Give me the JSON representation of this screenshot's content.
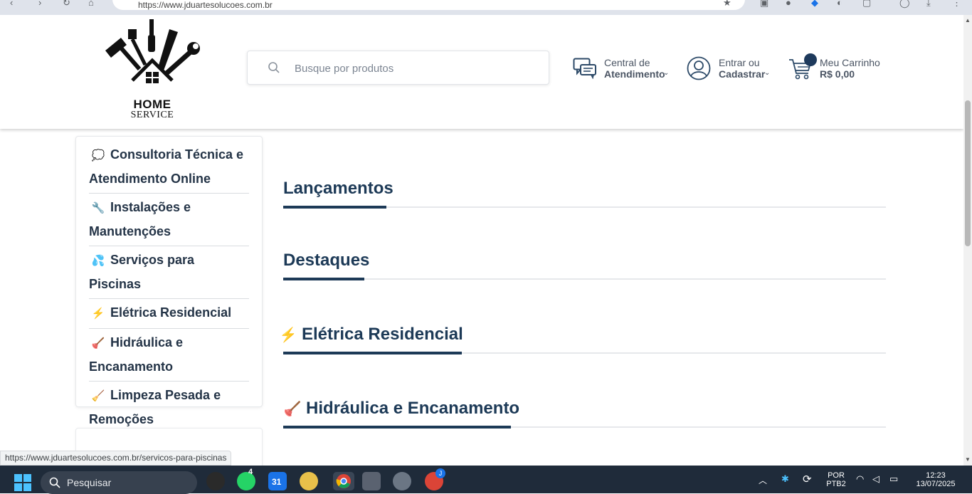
{
  "browser": {
    "url": "https://www.jduartesolucoes.com.br"
  },
  "header": {
    "logo_title": "HOME",
    "logo_subtitle": "SERVICE",
    "search_placeholder": "Busque por produtos",
    "support_line1": "Central de",
    "support_line2": "Atendimento",
    "account_line1": "Entrar ou",
    "account_line2": "Cadastrar",
    "cart_line1": "Meu Carrinho",
    "cart_line2": "R$ 0,00"
  },
  "sidebar": {
    "items": [
      {
        "icon": "speech-bubble",
        "emoji": "💭",
        "label": "Consultoria Técnica e Atendimento Online"
      },
      {
        "icon": "wrench",
        "emoji": "🔧",
        "label": "Instalações e Manutenções"
      },
      {
        "icon": "water-drops",
        "emoji": "💦",
        "label": "Serviços para Piscinas"
      },
      {
        "icon": "lightning",
        "emoji": "⚡",
        "label": "Elétrica Residencial"
      },
      {
        "icon": "plunger",
        "emoji": "🪠",
        "label": "Hidráulica e Encanamento"
      },
      {
        "icon": "broom",
        "emoji": "🧹",
        "label": "Limpeza Pesada e Remoções"
      }
    ]
  },
  "sections": [
    {
      "emoji": "",
      "title": "Lançamentos"
    },
    {
      "emoji": "",
      "title": "Destaques"
    },
    {
      "emoji": "⚡",
      "title": "Elétrica Residencial"
    },
    {
      "emoji": "🪠",
      "title": "Hidráulica e Encanamento"
    }
  ],
  "status_bar": {
    "hover_url": "https://www.jduartesolucoes.com.br/servicos-para-piscinas"
  },
  "taskbar": {
    "search_label": "Pesquisar",
    "whatsapp_badge": "4",
    "calendar_day": "31",
    "lang_line1": "POR",
    "lang_line2": "PTB2",
    "time": "12:23",
    "date": "13/07/2025",
    "profile_badge": "J"
  },
  "colors": {
    "brand_navy": "#1d3a57",
    "text_gray": "#4a5463",
    "taskbar_bg": "#1f2b3a"
  }
}
